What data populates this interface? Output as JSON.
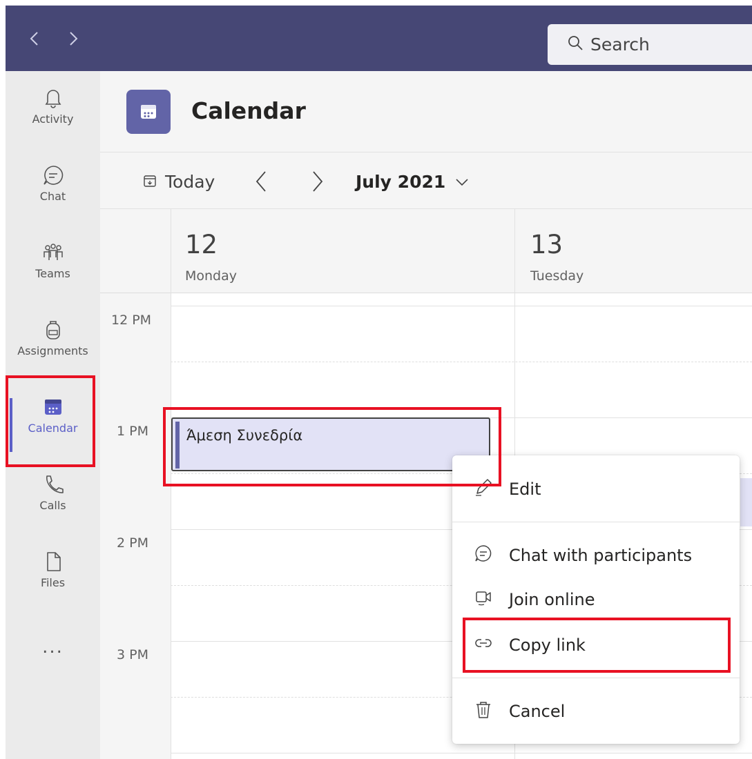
{
  "topbar": {
    "search_placeholder": "Search"
  },
  "rail": {
    "items": [
      {
        "label": "Activity",
        "icon": "bell-icon"
      },
      {
        "label": "Chat",
        "icon": "chat-icon"
      },
      {
        "label": "Teams",
        "icon": "teams-icon"
      },
      {
        "label": "Assignments",
        "icon": "backpack-icon"
      },
      {
        "label": "Calendar",
        "icon": "calendar-icon",
        "active": true
      },
      {
        "label": "Calls",
        "icon": "phone-icon"
      },
      {
        "label": "Files",
        "icon": "file-icon"
      }
    ],
    "more": "..."
  },
  "header": {
    "title": "Calendar"
  },
  "toolbar": {
    "today": "Today",
    "month": "July 2021"
  },
  "days": [
    {
      "number": "12",
      "name": "Monday"
    },
    {
      "number": "13",
      "name": "Tuesday"
    }
  ],
  "times": [
    "12 PM",
    "1 PM",
    "2 PM",
    "3 PM"
  ],
  "event": {
    "title": "Άμεση Συνεδρία"
  },
  "context_menu": {
    "items": [
      {
        "label": "Edit",
        "icon": "pencil-icon"
      },
      {
        "label": "Chat with participants",
        "icon": "chat-icon"
      },
      {
        "label": "Join online",
        "icon": "video-icon"
      },
      {
        "label": "Copy link",
        "icon": "link-icon"
      },
      {
        "label": "Cancel",
        "icon": "trash-icon"
      }
    ]
  },
  "colors": {
    "topbar": "#464775",
    "accent": "#6264a7",
    "highlight": "#e81123"
  }
}
